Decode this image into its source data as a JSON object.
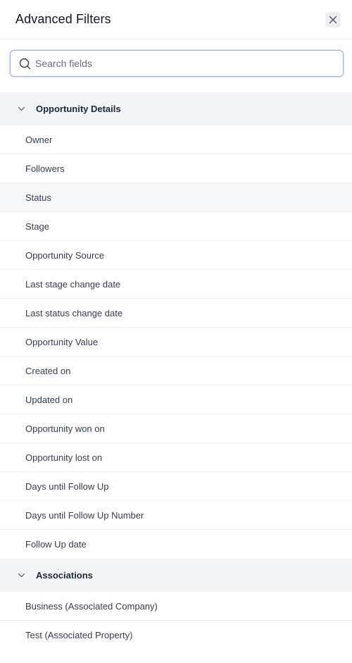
{
  "panel": {
    "title": "Advanced Filters",
    "close_icon": "close-icon"
  },
  "search": {
    "placeholder": "Search fields",
    "value": "",
    "icon": "search-icon"
  },
  "groups": [
    {
      "label": "Opportunity Details",
      "expanded": true,
      "icon": "chevron-down-icon",
      "items": [
        "Owner",
        "Followers",
        "Status",
        "Stage",
        "Opportunity Source",
        "Last stage change date",
        "Last status change date",
        "Opportunity Value",
        "Created on",
        "Updated on",
        "Opportunity won on",
        "Opportunity lost on",
        "Days until Follow Up",
        "Days until Follow Up Number",
        "Follow Up date"
      ]
    },
    {
      "label": "Associations",
      "expanded": true,
      "icon": "chevron-down-icon",
      "items": [
        "Business (Associated Company)",
        "Test (Associated Property)"
      ]
    }
  ],
  "colors": {
    "group_bg": "#f2f4f7",
    "focus_border": "#9fb4e6",
    "text": "#344054"
  }
}
